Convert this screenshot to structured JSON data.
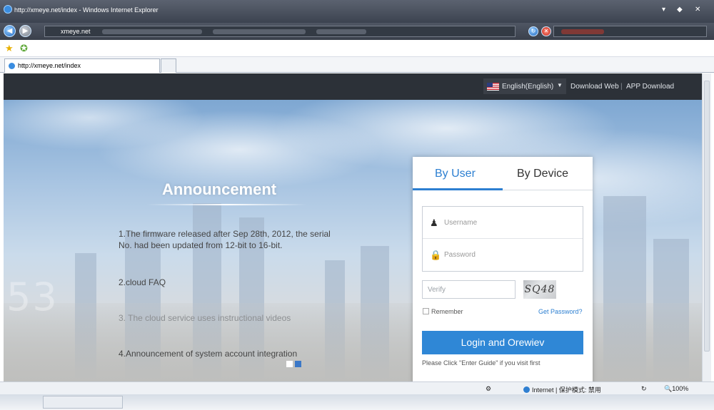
{
  "browser": {
    "window_title": "http://xmeye.net/index - Windows Internet Explorer",
    "address_text": "xmeye.net",
    "tab_title": "http://xmeye.net/index",
    "status": "Internet | 保护模式: 禁用",
    "zoom": "100%"
  },
  "header": {
    "language": "English(English)",
    "download_web": "Download Web",
    "separator": "|",
    "app_download": "APP Download"
  },
  "announcement": {
    "title": "Announcement",
    "items": [
      "1.The firmware released after Sep 28th, 2012, the serial No. had been updated from 12-bit to 16-bit.",
      "2.cloud FAQ",
      "3. The cloud service uses instructional videos",
      "4.Announcement of system account integration"
    ],
    "background_number": "53"
  },
  "login": {
    "tab_user": "By User",
    "tab_device": "By Device",
    "username_placeholder": "Username",
    "password_placeholder": "Password",
    "verify_placeholder": "Verify",
    "captcha": "SQ48",
    "remember": "Remember",
    "get_password": "Get Password?",
    "login_button": "Login and Orewiev",
    "guide": "Please Click \"Enter Guide\" if you visit first"
  },
  "colors": {
    "accent": "#2f87d6",
    "header_bg": "#2c3138"
  }
}
